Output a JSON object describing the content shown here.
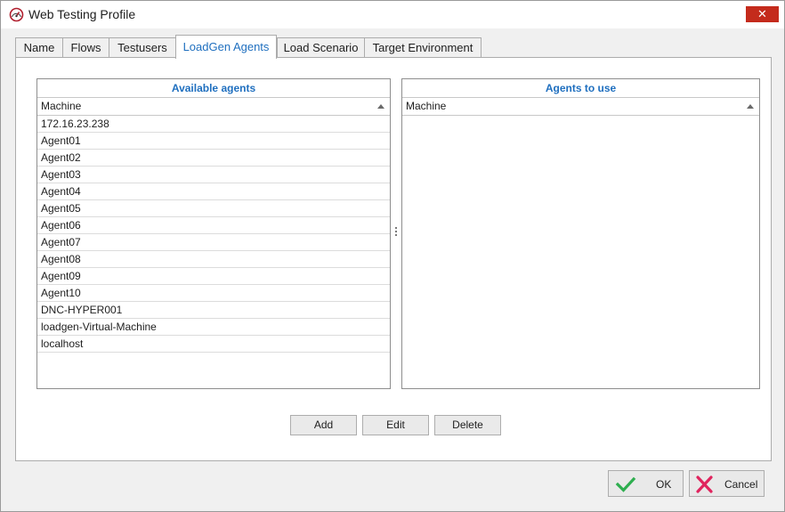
{
  "window": {
    "title": "Web Testing Profile",
    "close_glyph": "✕",
    "icon": "speedometer-icon"
  },
  "tabs": [
    {
      "label": "Name"
    },
    {
      "label": "Flows"
    },
    {
      "label": "Testusers"
    },
    {
      "label": "LoadGen Agents",
      "active": true
    },
    {
      "label": "Load Scenario"
    },
    {
      "label": "Target Environment"
    }
  ],
  "available": {
    "title": "Available agents",
    "column": "Machine",
    "rows": [
      "172.16.23.238",
      "Agent01",
      "Agent02",
      "Agent03",
      "Agent04",
      "Agent05",
      "Agent06",
      "Agent07",
      "Agent08",
      "Agent09",
      "Agent10",
      "DNC-HYPER001",
      "loadgen-Virtual-Machine",
      "localhost"
    ]
  },
  "to_use": {
    "title": "Agents to use",
    "column": "Machine",
    "rows": []
  },
  "actions": {
    "add": "Add",
    "edit": "Edit",
    "delete": "Delete"
  },
  "footer": {
    "ok": "OK",
    "cancel": "Cancel"
  },
  "colors": {
    "accent": "#1f6fbf",
    "close": "#c42b1c",
    "ok_check": "#2eae4f",
    "cancel_x": "#e0245e"
  }
}
